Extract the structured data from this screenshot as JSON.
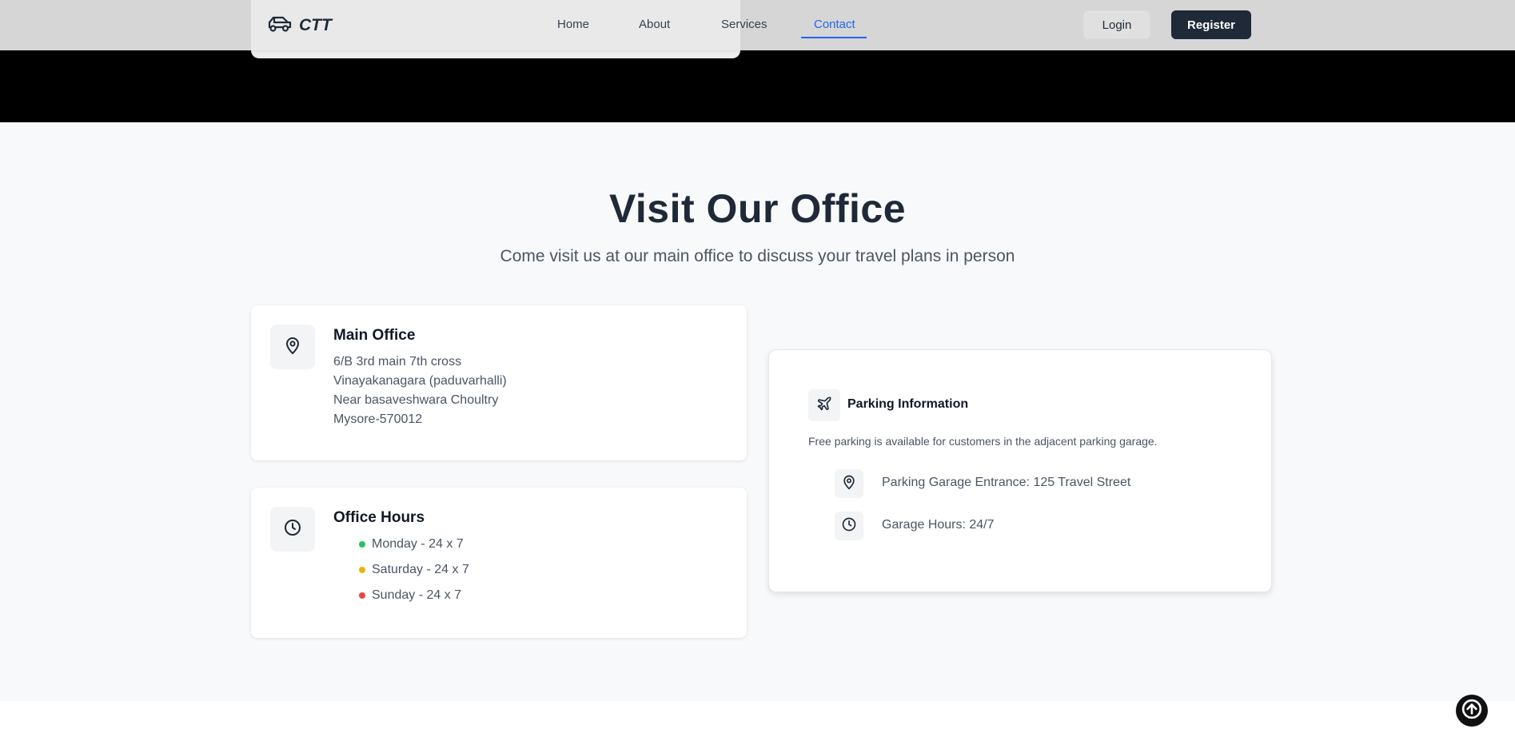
{
  "nav": {
    "brand": "CTT",
    "links": [
      "Home",
      "About",
      "Services",
      "Contact"
    ],
    "active": "Contact",
    "login_label": "Login",
    "register_label": "Register"
  },
  "section": {
    "title": "Visit Our Office",
    "subtitle": "Come visit us at our main office to discuss your travel plans in person"
  },
  "main_office": {
    "title": "Main Office",
    "address_lines": [
      "6/B 3rd main 7th cross",
      "Vinayakanagara (paduvarhalli)",
      "Near basaveshwara Choultry",
      "Mysore-570012"
    ],
    "icon": "map-pin-icon"
  },
  "office_hours": {
    "title": "Office Hours",
    "items": [
      {
        "label": "Monday - 24 x 7",
        "color": "#22c55e"
      },
      {
        "label": "Saturday - 24 x 7",
        "color": "#eab308"
      },
      {
        "label": "Sunday - 24 x 7",
        "color": "#ef4444"
      }
    ],
    "icon": "clock-icon"
  },
  "parking": {
    "title": "Parking Information",
    "description": "Free parking is available for customers in the adjacent parking garage.",
    "icon": "plane-icon",
    "items": [
      {
        "icon": "map-pin-icon",
        "label": "Parking Garage Entrance: 125 Travel Street"
      },
      {
        "icon": "clock-icon",
        "label": "Garage Hours: 24/7"
      }
    ]
  },
  "colors": {
    "accent": "#2563eb",
    "dark_button": "#1f2937",
    "hero_band": "#000000",
    "page_bg": "#f8f9fb"
  },
  "scroll_top_icon": "arrow-up-icon"
}
